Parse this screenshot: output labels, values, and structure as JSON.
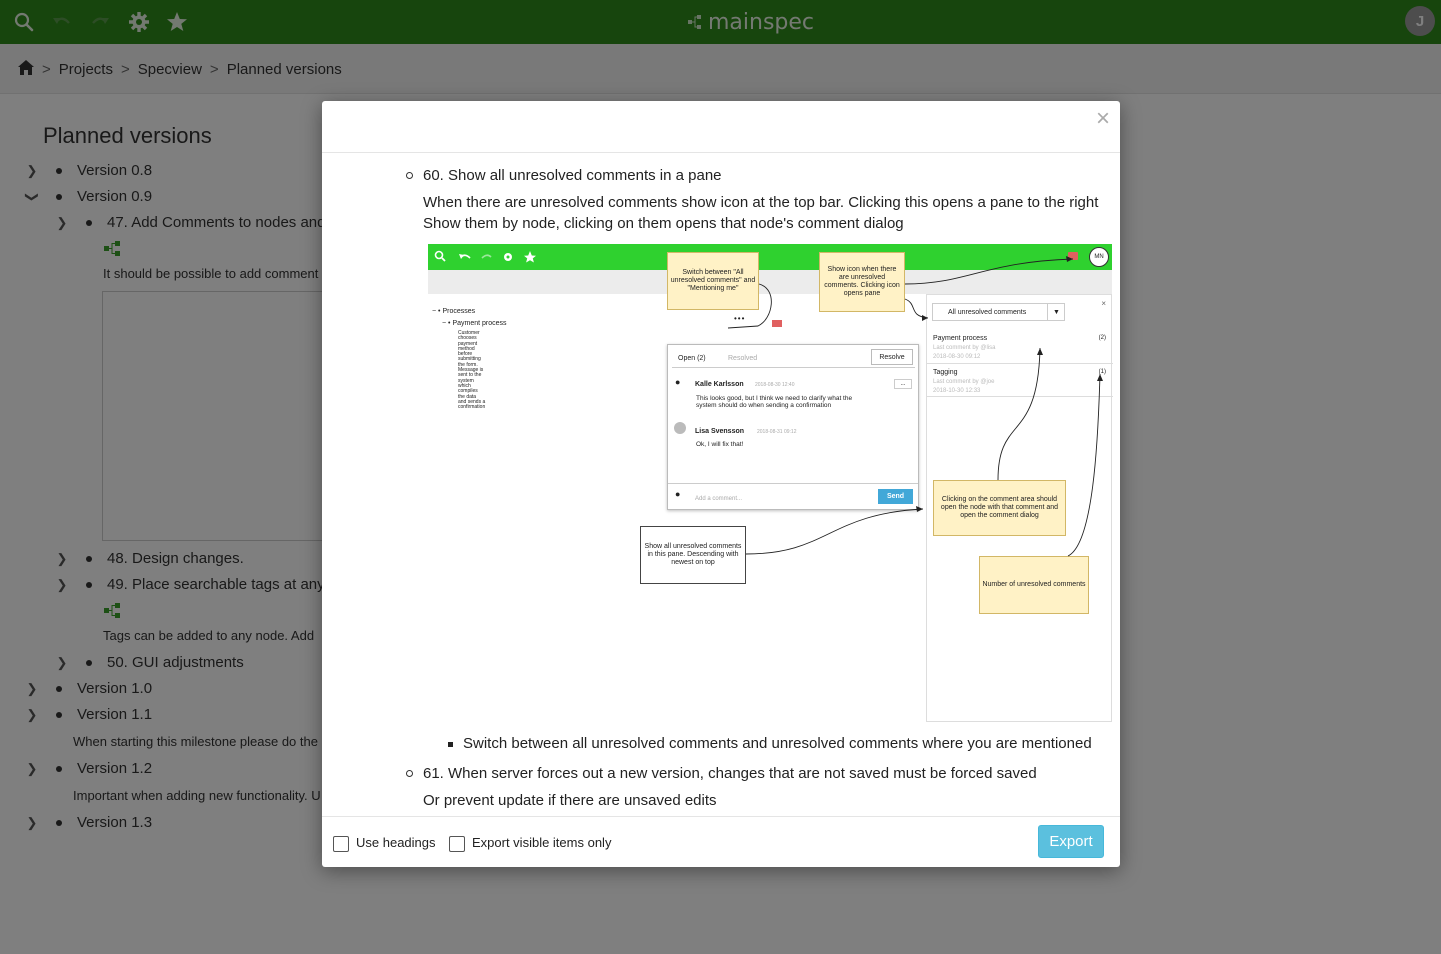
{
  "topbar": {
    "logo_text": "mainspec",
    "avatar_initial": "J",
    "icons": [
      "search-icon",
      "undo-icon",
      "redo-icon",
      "gear-icon",
      "star-icon"
    ]
  },
  "breadcrumb": {
    "items": [
      "Projects",
      "Specview",
      "Planned versions"
    ],
    "separator": ">"
  },
  "page": {
    "title": "Planned versions",
    "rows": [
      "Version 0.8",
      "Version 0.9",
      "47. Add Comments to nodes and",
      "48. Design changes.",
      "49. Place searchable tags at any",
      "50. GUI adjustments",
      "Version 1.0",
      "Version 1.1",
      "Version 1.2",
      "Version 1.3"
    ],
    "descs": {
      "d47": "It should be possible to add comment",
      "d49": "Tags can be added to any node. Add",
      "d11": "When starting this milestone please do the",
      "d12": "Important when adding new functionality. U"
    }
  },
  "modal": {
    "item60_title": "60. Show all unresolved comments in a pane",
    "item60_p1": "When there are unresolved comments show icon at the top bar. Clicking this opens a pane to the right",
    "item60_p2": "Show them by node, clicking on them opens that node's comment dialog",
    "sub_bullet": "Switch between all unresolved comments and unresolved comments where you are mentioned",
    "item61_title": "61. When server forces out a new version, changes that are not saved must be forced saved",
    "item61_p1": "Or prevent update if there are unsaved edits",
    "footer": {
      "use_headings": "Use headings",
      "export_visible": "Export visible items only",
      "export_button": "Export"
    }
  },
  "screenshot": {
    "avatar": "MN",
    "tree_root": "Processes",
    "tree_child": "Payment process",
    "tree_text": [
      "Customer",
      "chooses",
      "payment",
      "method",
      "before",
      "submitting",
      "the form.",
      "Message is",
      "sent to the",
      "system",
      "which",
      "compiles",
      "the data",
      "and sends a",
      "confirmation"
    ],
    "note1": "Switch between \"All unresolved comments\" and \"Mentioning me\"",
    "note2": "Show icon when there are unresolved comments. Clicking icon opens pane",
    "note3": "Clicking on the comment area should open the node with that comment and open the comment dialog",
    "note4": "Number of unresolved comments",
    "note5": "Show all unresolved comments in this pane. Descending with newest on top",
    "tab_open": "Open (2)",
    "tab_resolved": "Resolved",
    "resolve_btn": "Resolve",
    "c1_author": "Kalle Karlsson",
    "c1_date": "2018-08-30 12:40",
    "c1_text": "This looks good, but I think we need to clarify what the system should do when sending a confirmation",
    "c2_author": "Lisa Svensson",
    "c2_date": "2018-08-31 09:12",
    "c2_text": "Ok, I will fix that!",
    "add_placeholder": "Add a comment...",
    "send_btn": "Send",
    "more_btn": "...",
    "pane_select": "All unresolved comments",
    "pane_item1_title": "Payment process",
    "pane_item1_sub": "Last comment by @lisa",
    "pane_item1_date": "2018-08-30 09:12",
    "pane_item1_count": "(2)",
    "pane_item2_title": "Tagging",
    "pane_item2_sub": "Last comment by @joe",
    "pane_item2_date": "2018-10-30 12:33",
    "pane_item2_count": "(1)"
  }
}
